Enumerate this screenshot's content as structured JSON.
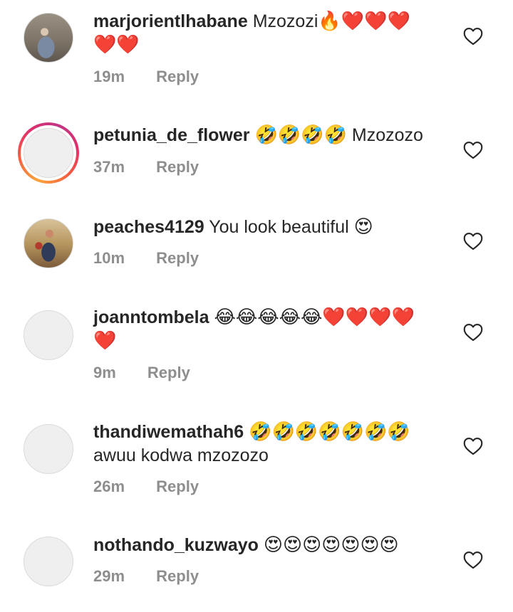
{
  "comments": [
    {
      "username": "marjorientlhabane",
      "text_line1": "Mzozozi",
      "emoji_line1": "🔥❤️❤️❤️",
      "emoji_line2": "❤️❤️",
      "time": "19m",
      "reply_label": "Reply"
    },
    {
      "username": "petunia_de_flower",
      "emoji_line1": "🤣🤣🤣🤣",
      "text_line1": "Mzozozo",
      "time": "37m",
      "reply_label": "Reply"
    },
    {
      "username": "peaches4129",
      "text_line1": "You look beautiful",
      "emoji_line1": "😍",
      "time": "10m",
      "reply_label": "Reply"
    },
    {
      "username": "joanntombela",
      "emoji_line1": "😂😂😂😂😂❤️❤️❤️❤️",
      "emoji_line2": "❤️",
      "time": "9m",
      "reply_label": "Reply"
    },
    {
      "username": "thandiwemathah6",
      "emoji_line1": "🤣🤣🤣🤣🤣🤣🤣",
      "text_line2": "awuu kodwa mzozozo",
      "time": "26m",
      "reply_label": "Reply"
    },
    {
      "username": "nothando_kuzwayo",
      "emoji_line1": "😍😍😍😍😍😍😍",
      "time": "29m",
      "reply_label": "Reply"
    }
  ],
  "icons": {
    "like": "heart-outline-icon"
  },
  "colors": {
    "text": "#262626",
    "meta": "#8e8e8e",
    "story_ring_start": "#f9a43b",
    "story_ring_end": "#c13584"
  }
}
